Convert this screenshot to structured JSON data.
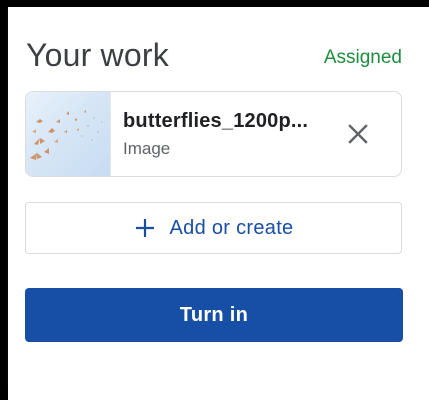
{
  "panel": {
    "title": "Your work",
    "status": "Assigned"
  },
  "attachment": {
    "file_name": "butterflies_1200p...",
    "file_type": "Image",
    "thumbnail_icon": "butterflies-image-thumbnail",
    "remove_icon": "close-icon"
  },
  "actions": {
    "add_label": "Add or create",
    "add_icon": "plus-icon",
    "turn_in_label": "Turn in"
  },
  "colors": {
    "status_green": "#1e8e3e",
    "primary_blue": "#174ea6",
    "title_gray": "#3c4043",
    "border_gray": "#dadce0"
  }
}
